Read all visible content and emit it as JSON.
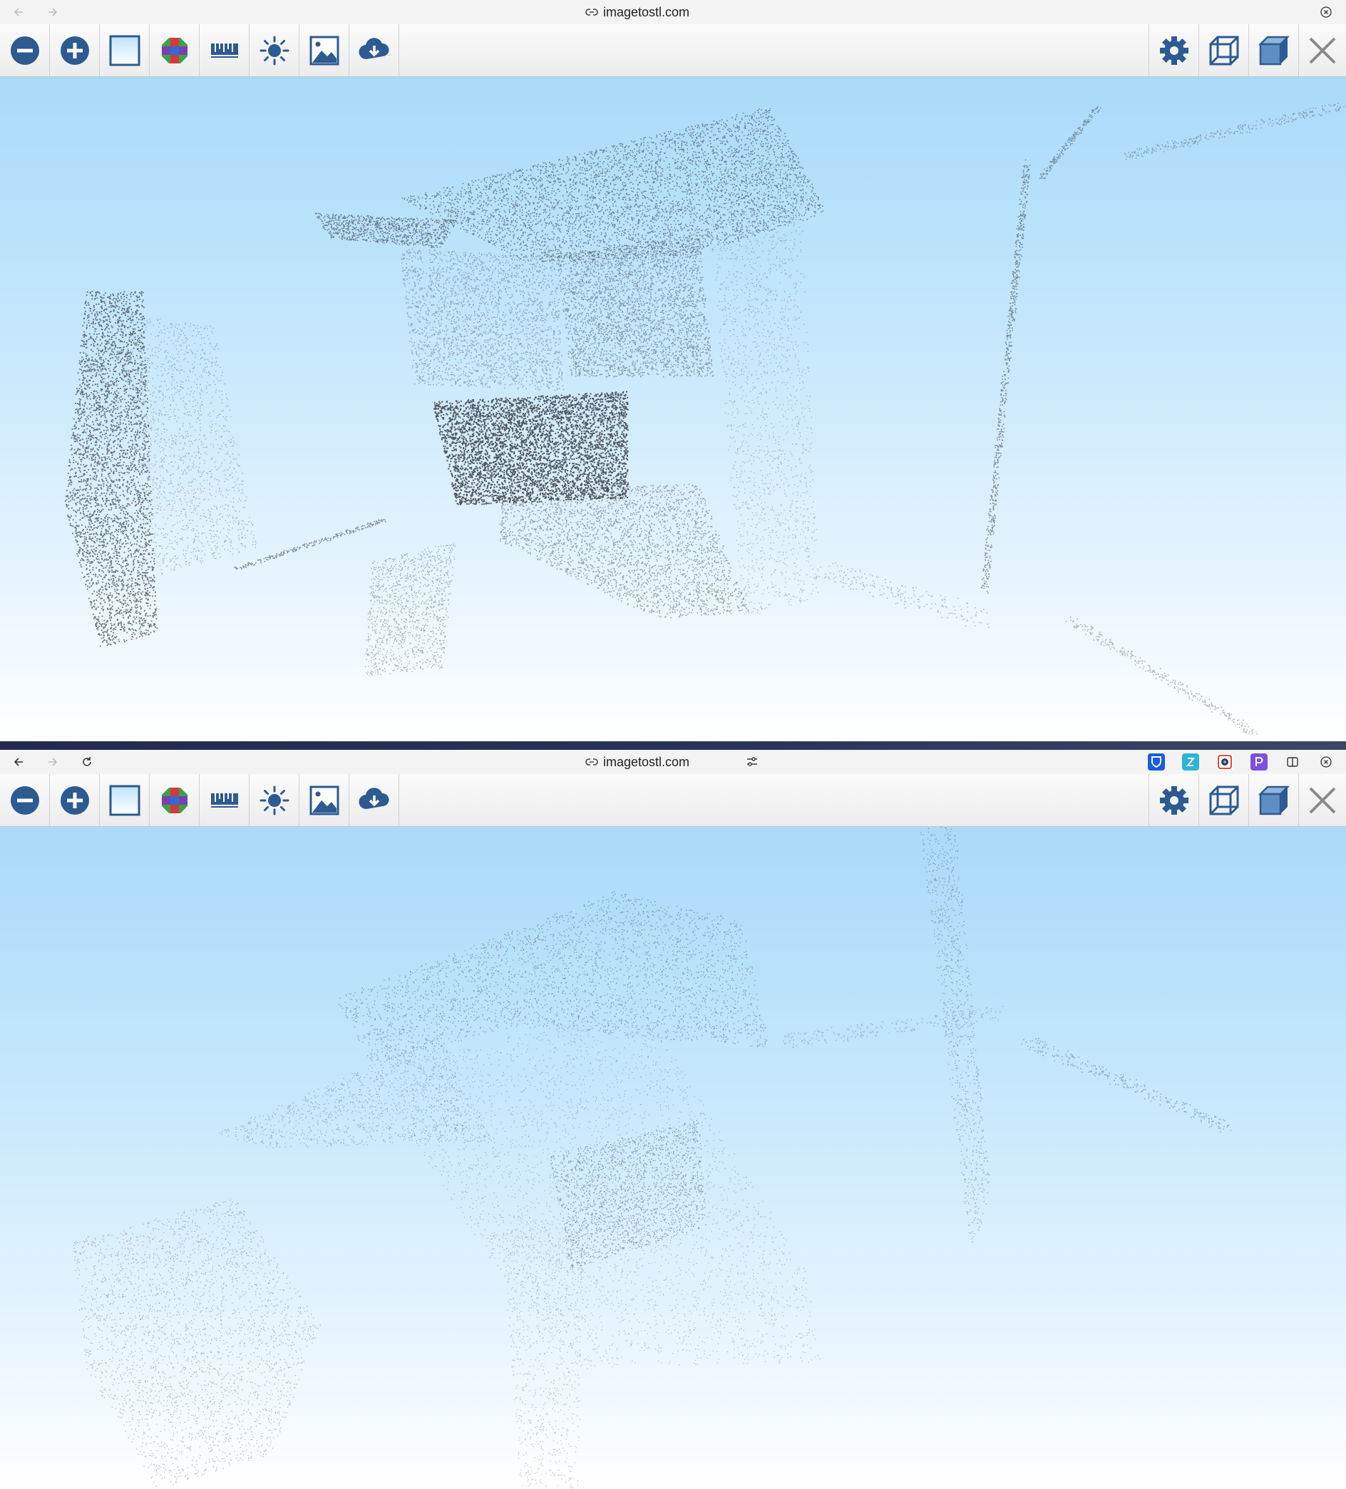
{
  "windows": [
    {
      "address_bar": {
        "url": "imagetostl.com",
        "show_reload": false,
        "show_extensions": false
      },
      "toolbar": {
        "left_tools": [
          "zoom-out",
          "zoom-in",
          "plane-white",
          "color-palette",
          "grid-ruler",
          "light-brightness",
          "image-texture",
          "cloud-download"
        ],
        "right_tools": [
          "settings",
          "wireframe-view",
          "solid-view",
          "close"
        ]
      },
      "viewport": {
        "content": "point-cloud-3d",
        "density": "dense"
      }
    },
    {
      "address_bar": {
        "url": "imagetostl.com",
        "show_reload": true,
        "show_extensions": true
      },
      "extensions": [
        "bitwarden-icon",
        "extension-z-icon",
        "camera-extension-icon",
        "extension-p-icon",
        "split-view-icon"
      ],
      "toolbar": {
        "left_tools": [
          "zoom-out",
          "zoom-in",
          "plane-white",
          "color-palette",
          "grid-ruler",
          "light-brightness",
          "image-texture",
          "cloud-download"
        ],
        "right_tools": [
          "settings",
          "wireframe-view",
          "solid-view",
          "close"
        ]
      },
      "viewport": {
        "content": "point-cloud-3d",
        "density": "sparse"
      }
    }
  ],
  "colors": {
    "accent": "#2d5a91",
    "sky_top": "#a9daf9",
    "sky_bottom": "#ffffff",
    "points": "#3a3d42"
  }
}
